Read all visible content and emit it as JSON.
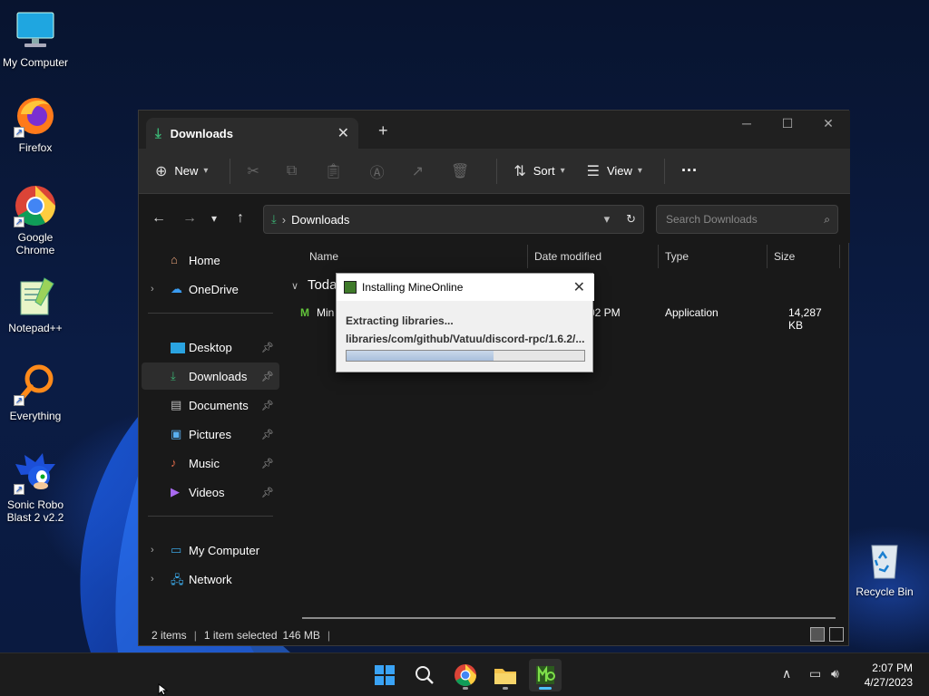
{
  "desktop": {
    "icons": [
      {
        "label": "My Computer",
        "icon": "monitor-icon"
      },
      {
        "label": "Firefox",
        "icon": "firefox-icon"
      },
      {
        "label": "Google Chrome",
        "icon": "chrome-icon"
      },
      {
        "label": "Notepad++",
        "icon": "notepadpp-icon"
      },
      {
        "label": "Everything",
        "icon": "everything-search-icon"
      },
      {
        "label": "Sonic Robo Blast 2 v2.2",
        "icon": "sonic-icon"
      },
      {
        "label": "Recycle Bin",
        "icon": "recycle-bin-icon"
      }
    ]
  },
  "explorer": {
    "tab_label": "Downloads",
    "new_tab": "+",
    "toolbar": {
      "new_label": "New",
      "sort_label": "Sort",
      "view_label": "View",
      "more": "···"
    },
    "address": {
      "path": "Downloads",
      "search_placeholder": "Search Downloads"
    },
    "sidebar": {
      "home": "Home",
      "onedrive": "OneDrive",
      "quick": [
        {
          "label": "Desktop",
          "pinned": true
        },
        {
          "label": "Downloads",
          "pinned": true,
          "active": true
        },
        {
          "label": "Documents",
          "pinned": true
        },
        {
          "label": "Pictures",
          "pinned": true
        },
        {
          "label": "Music",
          "pinned": true
        },
        {
          "label": "Videos",
          "pinned": true
        }
      ],
      "my_computer": "My Computer",
      "network": "Network"
    },
    "columns": {
      "name": "Name",
      "date_modified": "Date modified",
      "type": "Type",
      "size": "Size"
    },
    "group_label": "Today",
    "file_row": {
      "name": "Min",
      "date_fragment": "02 PM",
      "type": "Application",
      "size": "14,287 KB"
    },
    "status": {
      "items": "2 items",
      "selected": "1 item selected",
      "size": "146 MB"
    }
  },
  "installer": {
    "title": "Installing MineOnline",
    "status": "Extracting libraries...",
    "path": "libraries/com/github/Vatuu/discord-rpc/1.6.2/...",
    "progress": 0.62
  },
  "taskbar": {
    "time": "2:07 PM",
    "date": "4/27/2023"
  },
  "colors": {
    "accent": "#4cc2ff",
    "downloads_green": "#3bb273"
  }
}
